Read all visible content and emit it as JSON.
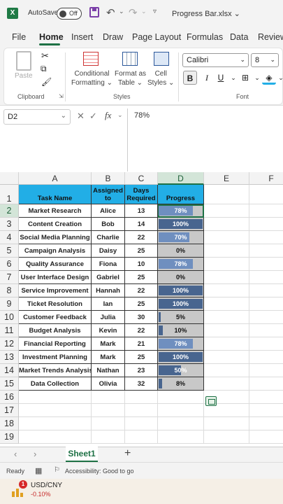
{
  "titlebar": {
    "app_logo": "X",
    "autosave_label": "AutoSave",
    "autosave_state": "Off",
    "filename": "Progress Bar.xlsx",
    "icons": [
      "save-icon",
      "undo-icon",
      "redo-icon",
      "customize-icon"
    ]
  },
  "ribbon_tabs": [
    "File",
    "Home",
    "Insert",
    "Draw",
    "Page Layout",
    "Formulas",
    "Data",
    "Review"
  ],
  "active_tab": "Home",
  "ribbon": {
    "clipboard": {
      "paste": "Paste",
      "group": "Clipboard"
    },
    "styles": {
      "conditional_formatting": [
        "Conditional",
        "Formatting ⌄"
      ],
      "format_as_table": [
        "Format as",
        "Table ⌄"
      ],
      "cell_styles": [
        "Cell",
        "Styles ⌄"
      ],
      "group": "Styles"
    },
    "font": {
      "name": "Calibri",
      "size": "8",
      "group": "Font",
      "bold": "B",
      "italic": "I",
      "underline": "U"
    }
  },
  "formula_bar": {
    "name_box": "D2",
    "fx": "fx",
    "value": "78%"
  },
  "columns": [
    "A",
    "B",
    "C",
    "D",
    "E",
    "F"
  ],
  "rows": [
    "1",
    "2",
    "3",
    "4",
    "5",
    "6",
    "7",
    "8",
    "9",
    "10",
    "11",
    "12",
    "13",
    "14",
    "15",
    "16",
    "17",
    "18",
    "19"
  ],
  "table": {
    "headers": {
      "task": "Task Name",
      "assigned": [
        "Assigned",
        "to"
      ],
      "days": [
        "Days",
        "Required"
      ],
      "progress": "Progress"
    },
    "rows": [
      {
        "task": "Market Research",
        "assigned": "Alice",
        "days": "13",
        "progress": "78%",
        "value": 0.78
      },
      {
        "task": "Content Creation",
        "assigned": "Bob",
        "days": "14",
        "progress": "100%",
        "value": 1.0
      },
      {
        "task": "Social Media Planning",
        "assigned": "Charlie",
        "days": "22",
        "progress": "70%",
        "value": 0.7
      },
      {
        "task": "Campaign Analysis",
        "assigned": "Daisy",
        "days": "25",
        "progress": "0%",
        "value": 0.0
      },
      {
        "task": "Quality Assurance",
        "assigned": "Fiona",
        "days": "10",
        "progress": "78%",
        "value": 0.78
      },
      {
        "task": "User Interface Design",
        "assigned": "Gabriel",
        "days": "25",
        "progress": "0%",
        "value": 0.0
      },
      {
        "task": "Service Improvement",
        "assigned": "Hannah",
        "days": "22",
        "progress": "100%",
        "value": 1.0
      },
      {
        "task": "Ticket Resolution",
        "assigned": "Ian",
        "days": "25",
        "progress": "100%",
        "value": 1.0
      },
      {
        "task": "Customer Feedback",
        "assigned": "Julia",
        "days": "30",
        "progress": "5%",
        "value": 0.05
      },
      {
        "task": "Budget Analysis",
        "assigned": "Kevin",
        "days": "22",
        "progress": "10%",
        "value": 0.1
      },
      {
        "task": "Financial Reporting",
        "assigned": "Mark",
        "days": "21",
        "progress": "78%",
        "value": 0.78
      },
      {
        "task": "Investment Planning",
        "assigned": "Mark",
        "days": "25",
        "progress": "100%",
        "value": 1.0
      },
      {
        "task": "Market Trends Analysis",
        "assigned": "Nathan",
        "days": "23",
        "progress": "50%",
        "value": 0.5
      },
      {
        "task": "Data Collection",
        "assigned": "Olivia",
        "days": "32",
        "progress": "8%",
        "value": 0.08
      }
    ]
  },
  "sheet_tabs": [
    "Sheet1"
  ],
  "add_sheet": "+",
  "status": {
    "ready": "Ready",
    "accessibility": "Accessibility: Good to go"
  },
  "ticker": {
    "badge": "1",
    "name": "USD/CNY",
    "change": "-0.10%"
  },
  "colors": {
    "header_fill": "#22aee6",
    "bar": "#48658f",
    "bar_track": "#c8c8c8",
    "accent": "#1e7145"
  }
}
